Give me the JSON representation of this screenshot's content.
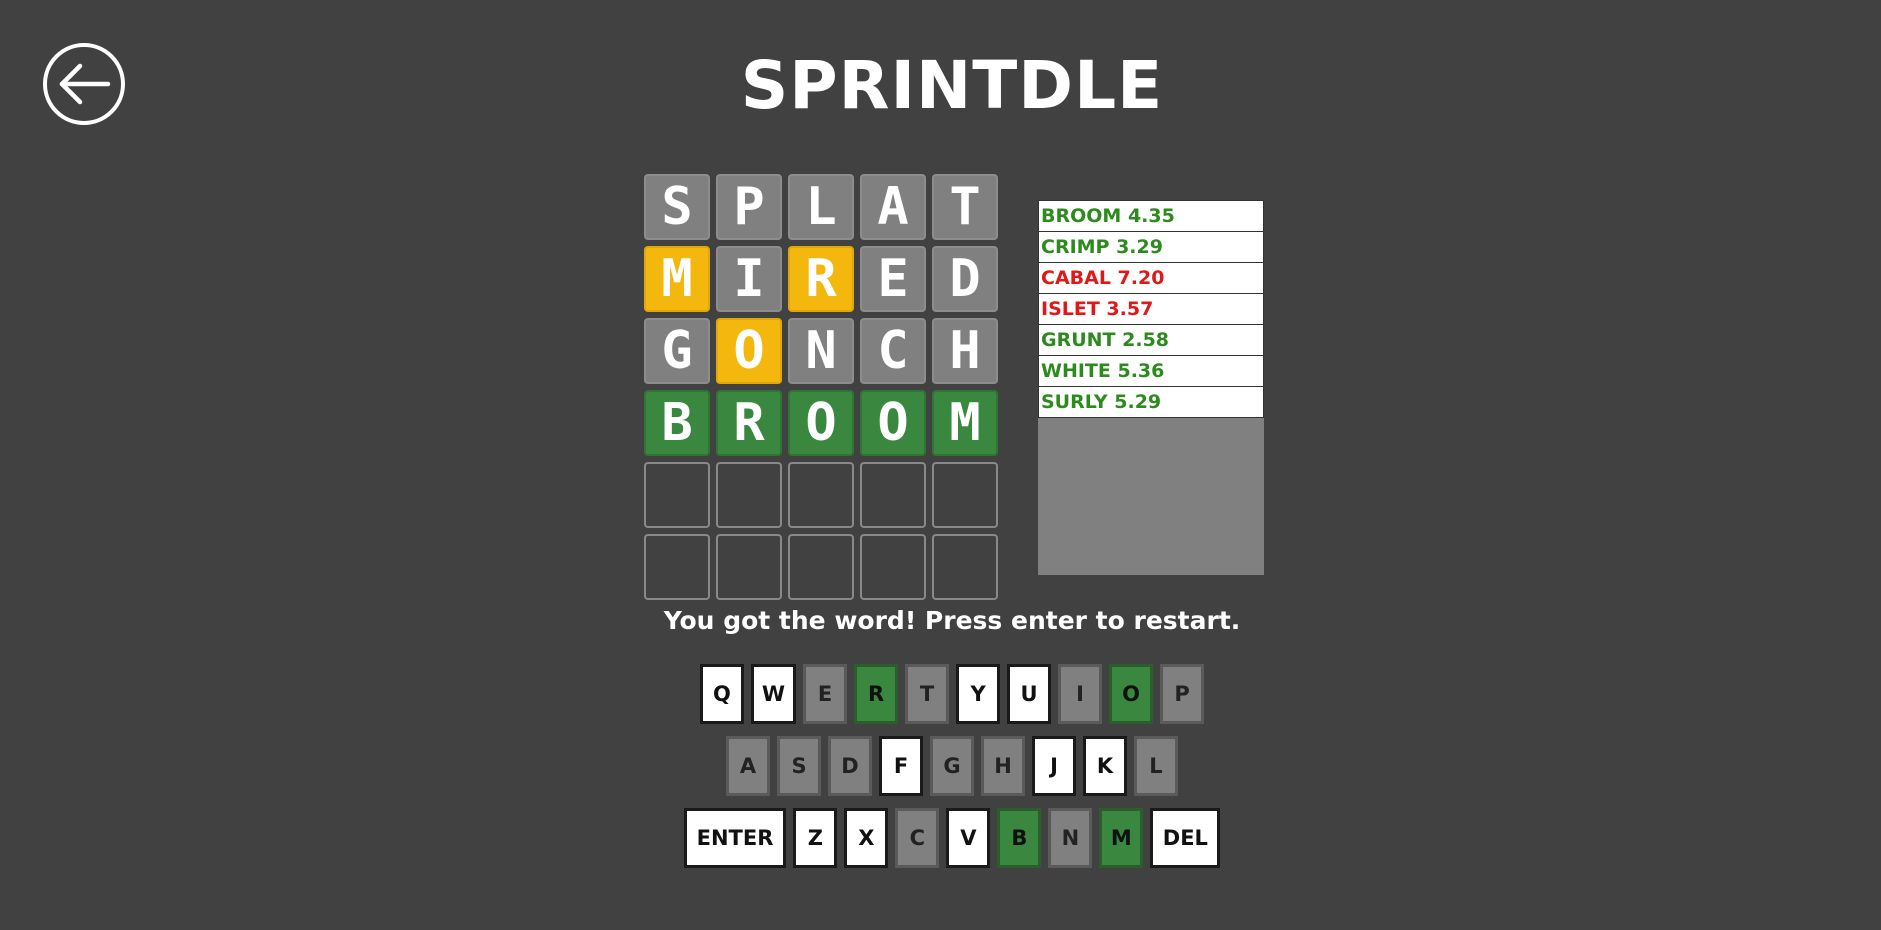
{
  "title": "SPRINTDLE",
  "back_icon": "arrow-left-icon",
  "colors": {
    "background": "#414141",
    "absent": "#808080",
    "present": "#f3b70d",
    "correct": "#3a873f",
    "history_win": "#2d8a1d",
    "history_loss": "#e01818"
  },
  "board": [
    [
      {
        "l": "S",
        "s": "absent"
      },
      {
        "l": "P",
        "s": "absent"
      },
      {
        "l": "L",
        "s": "absent"
      },
      {
        "l": "A",
        "s": "absent"
      },
      {
        "l": "T",
        "s": "absent"
      }
    ],
    [
      {
        "l": "M",
        "s": "present"
      },
      {
        "l": "I",
        "s": "absent"
      },
      {
        "l": "R",
        "s": "present"
      },
      {
        "l": "E",
        "s": "absent"
      },
      {
        "l": "D",
        "s": "absent"
      }
    ],
    [
      {
        "l": "G",
        "s": "absent"
      },
      {
        "l": "O",
        "s": "present"
      },
      {
        "l": "N",
        "s": "absent"
      },
      {
        "l": "C",
        "s": "absent"
      },
      {
        "l": "H",
        "s": "absent"
      }
    ],
    [
      {
        "l": "B",
        "s": "correct"
      },
      {
        "l": "R",
        "s": "correct"
      },
      {
        "l": "O",
        "s": "correct"
      },
      {
        "l": "O",
        "s": "correct"
      },
      {
        "l": "M",
        "s": "correct"
      }
    ],
    [
      {
        "l": "",
        "s": "empty"
      },
      {
        "l": "",
        "s": "empty"
      },
      {
        "l": "",
        "s": "empty"
      },
      {
        "l": "",
        "s": "empty"
      },
      {
        "l": "",
        "s": "empty"
      }
    ],
    [
      {
        "l": "",
        "s": "empty"
      },
      {
        "l": "",
        "s": "empty"
      },
      {
        "l": "",
        "s": "empty"
      },
      {
        "l": "",
        "s": "empty"
      },
      {
        "l": "",
        "s": "empty"
      }
    ]
  ],
  "history": [
    {
      "text": "BROOM 4.35",
      "status": "win"
    },
    {
      "text": "CRIMP 3.29",
      "status": "win"
    },
    {
      "text": "CABAL 7.20",
      "status": "loss"
    },
    {
      "text": "ISLET 3.57",
      "status": "loss"
    },
    {
      "text": "GRUNT 2.58",
      "status": "win"
    },
    {
      "text": "WHITE 5.36",
      "status": "win"
    },
    {
      "text": "SURLY 5.29",
      "status": "win"
    }
  ],
  "message": "You got the word! Press enter to restart.",
  "keyboard": [
    [
      {
        "k": "Q",
        "s": "unused"
      },
      {
        "k": "W",
        "s": "unused"
      },
      {
        "k": "E",
        "s": "absent"
      },
      {
        "k": "R",
        "s": "correct"
      },
      {
        "k": "T",
        "s": "absent"
      },
      {
        "k": "Y",
        "s": "unused"
      },
      {
        "k": "U",
        "s": "unused"
      },
      {
        "k": "I",
        "s": "absent"
      },
      {
        "k": "O",
        "s": "correct"
      },
      {
        "k": "P",
        "s": "absent"
      }
    ],
    [
      {
        "k": "A",
        "s": "absent"
      },
      {
        "k": "S",
        "s": "absent"
      },
      {
        "k": "D",
        "s": "absent"
      },
      {
        "k": "F",
        "s": "unused"
      },
      {
        "k": "G",
        "s": "absent"
      },
      {
        "k": "H",
        "s": "absent"
      },
      {
        "k": "J",
        "s": "unused"
      },
      {
        "k": "K",
        "s": "unused"
      },
      {
        "k": "L",
        "s": "absent"
      }
    ],
    [
      {
        "k": "ENTER",
        "s": "unused",
        "wide": true
      },
      {
        "k": "Z",
        "s": "unused"
      },
      {
        "k": "X",
        "s": "unused"
      },
      {
        "k": "C",
        "s": "absent"
      },
      {
        "k": "V",
        "s": "unused"
      },
      {
        "k": "B",
        "s": "correct"
      },
      {
        "k": "N",
        "s": "absent"
      },
      {
        "k": "M",
        "s": "correct"
      },
      {
        "k": "DEL",
        "s": "unused",
        "del": true
      }
    ]
  ]
}
